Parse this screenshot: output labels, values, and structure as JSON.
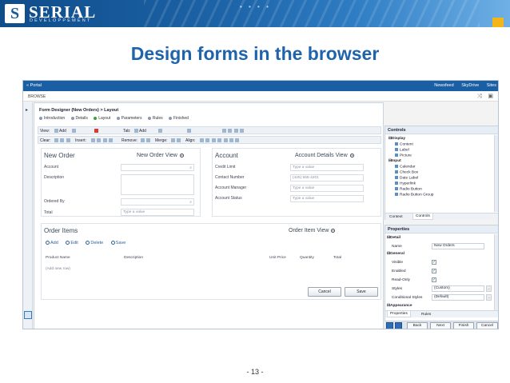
{
  "slide": {
    "logo_letter": "S",
    "logo_name": "SERIAL",
    "logo_sub": "DEVELOPPEMENT",
    "title": "Design forms in the browser",
    "page": "- 13 -"
  },
  "colors": {
    "header_blue": "#1d64a8",
    "title_blue": "#1f63ad",
    "accent_yellow": "#f2b51a",
    "sharepoint_bar": "#1a5ea4"
  },
  "sp": {
    "portal": "« Portal",
    "links": [
      "Newsfeed",
      "SkyDrive",
      "Sites"
    ],
    "browse": "BROWSE"
  },
  "designer": {
    "title": "Form Designer (New Orders) > Layout",
    "steps": [
      "Introduction",
      "Details",
      "Layout",
      "Parameters",
      "Rules",
      "Finished"
    ],
    "current_step": "Layout",
    "toolbar1": {
      "view": "View:",
      "add": "Add",
      "tab": "Tab:",
      "tab_add": "Add"
    },
    "toolbar2": {
      "clear": "Clear:",
      "insert": "Insert:",
      "remove": "Remove:",
      "merge": "Merge:",
      "align": "Align:"
    }
  },
  "order": {
    "title": "New Order",
    "view": "New Order View",
    "fields": [
      "Account",
      "Description",
      "Ordered By",
      "Total"
    ],
    "placeholder": "Type a value"
  },
  "account": {
    "title": "Account",
    "view": "Account Details View",
    "fields": [
      "Credit Limit",
      "Contact Number",
      "Account Manager",
      "Account Status"
    ],
    "values": [
      "Type a value",
      "(425) 555-4201",
      "Type a value",
      "Type a value"
    ]
  },
  "items": {
    "title": "Order Items",
    "view": "Order Item View",
    "actions": [
      "Add",
      "Edit",
      "Delete",
      "Save"
    ],
    "columns": [
      "Product Name",
      "Description",
      "Unit Price",
      "Quantity",
      "Total"
    ],
    "add_row": "(Add new row)",
    "cancel": "Cancel",
    "save": "Save"
  },
  "controls": {
    "title": "Controls",
    "groups": [
      {
        "name": "Display",
        "items": [
          "Content",
          "Label",
          "Picture"
        ]
      },
      {
        "name": "Input",
        "items": [
          "Calendar",
          "Check Box",
          "Date Label",
          "Hyperlink",
          "Radio Button",
          "Radio Button Group"
        ]
      }
    ],
    "tabs": [
      "Context",
      "Controls"
    ]
  },
  "properties": {
    "title": "Properties",
    "detail": "Detail",
    "name_label": "Name",
    "name_value": "New Orders",
    "general": "General",
    "flags": [
      "Visible",
      "Enabled",
      "Read-Only"
    ],
    "styles_label": "Styles",
    "styles_value": "(Custom)",
    "cond_label": "Conditional Styles",
    "cond_value": "(Default)",
    "appearance": "Appearance",
    "tabs": [
      "Properties",
      "Rules"
    ]
  },
  "nav": {
    "back": "Back",
    "next": "Next",
    "finish": "Finish",
    "cancel": "Cancel"
  }
}
